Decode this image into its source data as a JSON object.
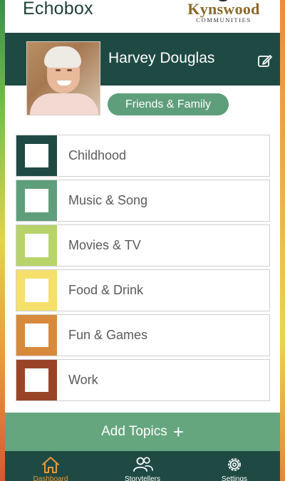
{
  "app": {
    "title": "Echobox",
    "brand_name": "Kynswood",
    "brand_sub": "COMMUNITIES"
  },
  "profile": {
    "name": "Harvey Douglas",
    "group": "Friends & Family"
  },
  "topics": [
    {
      "label": "Childhood",
      "color": "#1f4a44"
    },
    {
      "label": "Music & Song",
      "color": "#5e9e7b"
    },
    {
      "label": "Movies & TV",
      "color": "#b7d36a"
    },
    {
      "label": "Food & Drink",
      "color": "#f4e06a"
    },
    {
      "label": "Fun & Games",
      "color": "#d88a3c"
    },
    {
      "label": "Work",
      "color": "#9a4427"
    }
  ],
  "actions": {
    "add_topics_label": "Add Topics",
    "add_icon": "plus-icon"
  },
  "tabs": [
    {
      "label": "Dashboard",
      "icon": "home-icon",
      "active": true
    },
    {
      "label": "Storytellers",
      "icon": "people-icon",
      "active": false
    },
    {
      "label": "Settings",
      "icon": "gear-icon",
      "active": false
    }
  ],
  "colors": {
    "primary": "#1f4a44",
    "accent_green": "#65a67f",
    "active_tab": "#e79a3c"
  }
}
